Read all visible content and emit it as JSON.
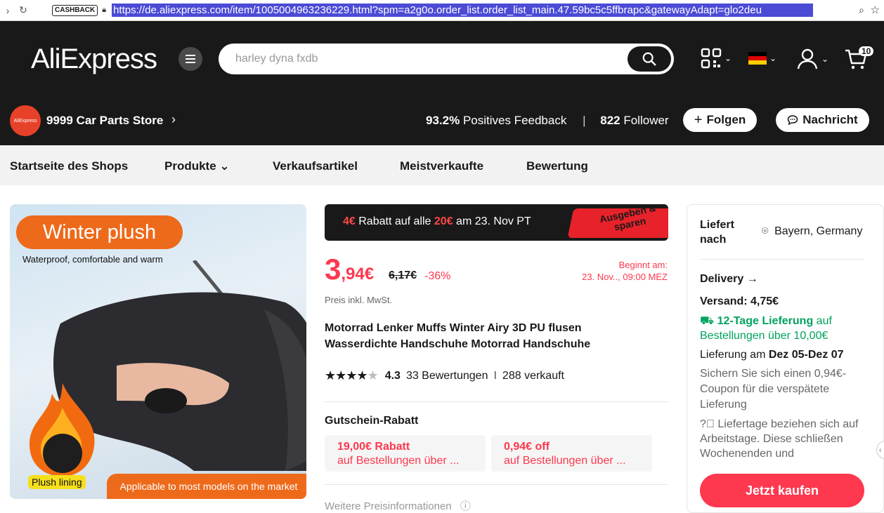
{
  "browser": {
    "cashback_badge": "CASHBACK",
    "url": "https://de.aliexpress.com/item/1005004963236229.html?spm=a2g0o.order_list.order_list_main.47.59bc5c5ffbrapc&gatewayAdapt=glo2deu"
  },
  "header": {
    "logo": "AliExpress",
    "search_placeholder": "harley dyna fxdb",
    "cart_count": "10"
  },
  "store": {
    "logo_text": "AliExpress",
    "name": "9999 Car Parts Store",
    "positive_value": "93.2%",
    "positive_label": "Positives Feedback",
    "separator": "|",
    "followers_value": "822",
    "followers_label": "Follower",
    "follow_label": "Folgen",
    "message_label": "Nachricht"
  },
  "shopnav": {
    "items": [
      "Startseite des Shops",
      "Produkte",
      "Verkaufsartikel",
      "Meistverkaufte",
      "Bewertung"
    ]
  },
  "image": {
    "badge": "Winter plush",
    "subtitle": "Waterproof, comfortable and warm",
    "plush_label": "Plush lining",
    "applicable_label": "Applicable to most models on the market"
  },
  "promo": {
    "amount": "4€",
    "text1": "Rabatt auf alle",
    "threshold": "20€",
    "text2": "am 23. Nov PT",
    "tag": "Ausgeben & sparen"
  },
  "price": {
    "integer": "3",
    "decimal": ",94€",
    "old": "6,17€",
    "discount": "-36%",
    "begins_label": "Beginnt am:",
    "begins_date": "23. Nov.., 09:00 MEZ",
    "tax_note": "Preis inkl. MwSt."
  },
  "product": {
    "title": "Motorrad Lenker Muffs Winter Airy 3D PU flusen Wasserdichte Handschuhe Motorrad Handschuhe",
    "rating": 4.3,
    "rating_text": "4.3",
    "reviews": "33 Bewertungen",
    "sold_separator": "I",
    "sold": "288 verkauft"
  },
  "coupons": {
    "heading": "Gutschein-Rabatt",
    "items": [
      {
        "amount": "19,00€ Rabatt",
        "condition": "auf Bestellungen über ..."
      },
      {
        "amount": "0,94€ off",
        "condition": "auf Bestellungen über ..."
      }
    ],
    "more_info": "Weitere Preisinformationen"
  },
  "delivery": {
    "deliver_to": "Liefert nach",
    "location": "Bayern, Germany",
    "delivery_label": "Delivery",
    "shipping": "Versand: 4,75€",
    "fast_label": "12-Tage Lieferung",
    "fast_condition": "auf Bestellungen über 10,00€",
    "date_label": "Lieferung am",
    "date_value": "Dez 05-Dez 07",
    "coupon_note": "Sichern Sie sich einen 0,94€-Coupon für die verspätete Lieferung",
    "days_note": "Liefertage beziehen sich auf Arbeitstage. Diese schließen Wochenenden und",
    "buy_label": "Jetzt kaufen"
  },
  "colors": {
    "brand_red": "#fd384f",
    "header_bg": "#191919",
    "green": "#00a35f",
    "orange": "#ee6a1b"
  }
}
